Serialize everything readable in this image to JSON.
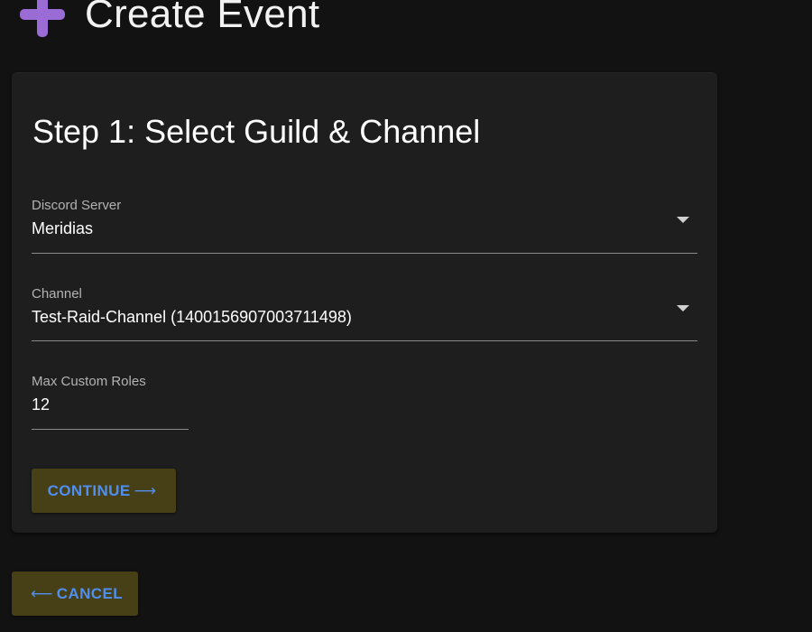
{
  "header": {
    "title": "Create Event",
    "icon": "plus-icon",
    "icon_color": "#9b6bd6"
  },
  "card": {
    "step_title": "Step 1: Select Guild & Channel",
    "fields": {
      "server": {
        "label": "Discord Server",
        "value": "Meridias",
        "type": "select"
      },
      "channel": {
        "label": "Channel",
        "value": "Test-Raid-Channel (1400156907003711498)",
        "type": "select"
      },
      "max_roles": {
        "label": "Max Custom Roles",
        "value": "12",
        "type": "number"
      }
    },
    "continue_button": {
      "label": "CONTINUE",
      "arrow": "⟶"
    }
  },
  "cancel_button": {
    "label": "CANCEL",
    "arrow": "⟵"
  },
  "colors": {
    "background": "#121212",
    "card": "#1e1e1e",
    "button_bg": "#473f16",
    "button_text": "#4f8ff0"
  }
}
